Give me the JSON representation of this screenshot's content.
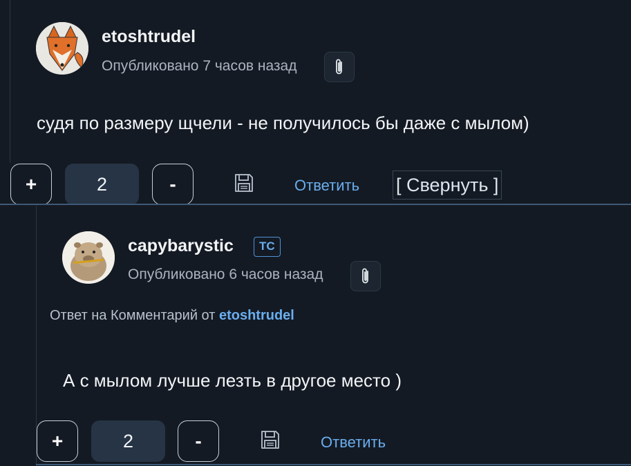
{
  "comments": [
    {
      "username": "etoshtrudel",
      "meta": "Опубликовано 7 часов назад",
      "text": "судя по размеру щчели - не получилось бы даже с мылом)",
      "votes": {
        "plus": "+",
        "count": "2",
        "minus": "-"
      },
      "reply_label": "Ответить",
      "collapse_label": "[ Свернуть ]"
    },
    {
      "username": "capybarystic",
      "badge": "ТС",
      "meta": "Опубликовано 6 часов назад",
      "reply_to_prefix": "Ответ на Комментарий от",
      "reply_to_author": "etoshtrudel",
      "text": "А с мылом лучше лезть в другое место )",
      "votes": {
        "plus": "+",
        "count": "2",
        "minus": "-"
      },
      "reply_label": "Ответить"
    }
  ],
  "colors": {
    "background": "#141a23",
    "accent": "#6aaeef",
    "separator": "#3d5a78"
  },
  "icons": [
    "fox-avatar",
    "capybara-avatar",
    "paperclip-icon",
    "save-icon"
  ]
}
